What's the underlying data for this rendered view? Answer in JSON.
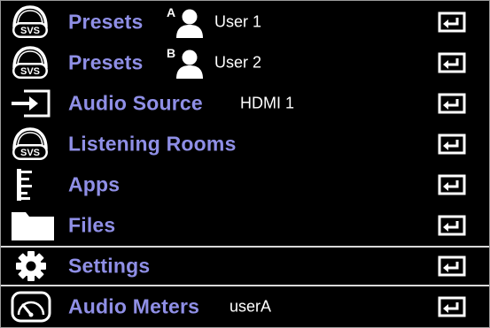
{
  "menu": {
    "items": [
      {
        "label": "Presets",
        "value": "User 1",
        "user_letter": "A",
        "icon": "svs-headphones-icon"
      },
      {
        "label": "Presets",
        "value": "User 2",
        "user_letter": "B",
        "icon": "svs-headphones-icon"
      },
      {
        "label": "Audio Source",
        "value": "HDMI 1",
        "icon": "input-source-icon"
      },
      {
        "label": "Listening Rooms",
        "icon": "svs-headphones-icon"
      },
      {
        "label": "Apps",
        "icon": "apps-list-icon"
      },
      {
        "label": "Files",
        "icon": "folder-icon"
      },
      {
        "label": "Settings",
        "icon": "gear-icon",
        "selected": true
      },
      {
        "label": "Audio Meters",
        "value": "userA",
        "icon": "gauge-icon"
      }
    ],
    "badge_text": "SVS",
    "enter_icon": "enter-icon"
  },
  "colors": {
    "background": "#000000",
    "label": "#8f8fe6",
    "value": "#ffffff",
    "selection_border": "#d9d9d9"
  }
}
